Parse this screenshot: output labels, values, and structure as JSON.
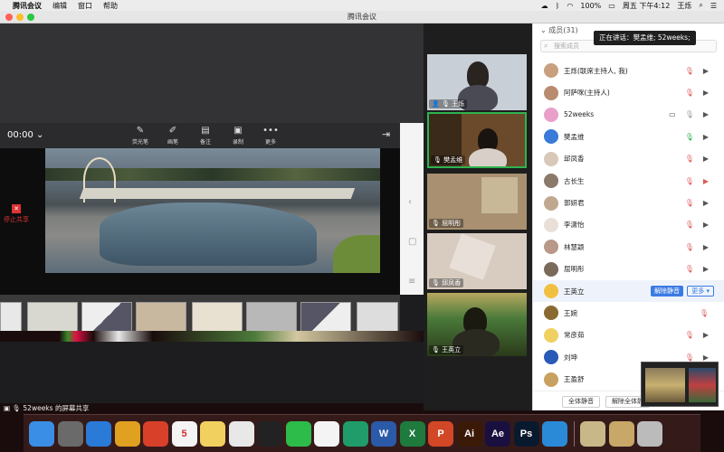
{
  "menubar": {
    "app_name": "腾讯会议",
    "items": [
      "编辑",
      "窗口",
      "帮助"
    ],
    "battery": "100%",
    "datetime": "周五 下午4:12",
    "user": "王烁"
  },
  "window": {
    "title": "腾讯会议"
  },
  "toolbar": {
    "timer": "00:00",
    "buttons": [
      {
        "label": "荧光笔",
        "icon": "highlighter-icon"
      },
      {
        "label": "画笔",
        "icon": "pen-icon"
      },
      {
        "label": "备注",
        "icon": "note-icon"
      },
      {
        "label": "录制",
        "icon": "record-icon"
      },
      {
        "label": "更多",
        "icon": "more-icon"
      }
    ]
  },
  "share": {
    "stop_label": "停止共享",
    "status": "52weeks 的屏幕共享"
  },
  "videos": [
    {
      "name": "王烁",
      "host": true
    },
    {
      "name": "樊孟维",
      "active": true
    },
    {
      "name": "屈明彤"
    },
    {
      "name": "邱凤香"
    },
    {
      "name": "王英立"
    }
  ],
  "participants_panel": {
    "header": "成员(31)",
    "search_placeholder": "搜索成员",
    "speaking": "正在讲话：樊孟维; 52weeks;",
    "members": [
      {
        "name": "王烁(联席主持人, 我)",
        "mic": "off",
        "cam": "on"
      },
      {
        "name": "阿萨咪(主持人)",
        "mic": "off",
        "cam": "on"
      },
      {
        "name": "52weeks",
        "mic": "muted",
        "cam": "on",
        "screen": true
      },
      {
        "name": "樊孟维",
        "mic": "on",
        "cam": "on"
      },
      {
        "name": "邱凤香",
        "mic": "off",
        "cam": "on"
      },
      {
        "name": "古长生",
        "mic": "off",
        "cam": "off"
      },
      {
        "name": "郭妍君",
        "mic": "off",
        "cam": "on"
      },
      {
        "name": "李潇怡",
        "mic": "off",
        "cam": "on"
      },
      {
        "name": "林慧颖",
        "mic": "off",
        "cam": "on"
      },
      {
        "name": "屈明彤",
        "mic": "off",
        "cam": "on"
      },
      {
        "name": "王英立",
        "mic": "off",
        "cam": "",
        "highlight": true
      },
      {
        "name": "王婉",
        "mic": "off",
        "cam": ""
      },
      {
        "name": "常彦茹",
        "mic": "off",
        "cam": "on"
      },
      {
        "name": "刘坤",
        "mic": "off",
        "cam": "on"
      },
      {
        "name": "王盈舒",
        "mic": "off",
        "cam": "on"
      }
    ],
    "unmute_label": "解除静音",
    "more_label": "更多",
    "mute_all_label": "全体静音",
    "unmute_all_label": "解除全体静"
  },
  "dock": {
    "apps": [
      {
        "icon": "finder-icon",
        "glyph": "",
        "color": "#3a8ee6"
      },
      {
        "icon": "launchpad-icon",
        "glyph": "",
        "color": "#6a6a6a"
      },
      {
        "icon": "safari-icon",
        "glyph": "",
        "color": "#2a7ad8"
      },
      {
        "icon": "chrome-canary-icon",
        "glyph": "",
        "color": "#e0a020"
      },
      {
        "icon": "chrome-icon",
        "glyph": "",
        "color": "#d8402a"
      },
      {
        "icon": "calendar-icon",
        "glyph": "5",
        "color": "#f4f4f4"
      },
      {
        "icon": "notes-icon",
        "glyph": "",
        "color": "#f2d060"
      },
      {
        "icon": "photos-icon",
        "glyph": "",
        "color": "#e8e8e8"
      },
      {
        "icon": "qq-icon",
        "glyph": "",
        "color": "#222222"
      },
      {
        "icon": "wechat-icon",
        "glyph": "",
        "color": "#2dbb4a"
      },
      {
        "icon": "tencent-meeting-icon",
        "glyph": "",
        "color": "#f4f4f4"
      },
      {
        "icon": "cad-icon",
        "glyph": "",
        "color": "#1f9c6a"
      },
      {
        "icon": "word-icon",
        "glyph": "W",
        "color": "#2a5aa8"
      },
      {
        "icon": "excel-icon",
        "glyph": "X",
        "color": "#1f7a3e"
      },
      {
        "icon": "powerpoint-icon",
        "glyph": "P",
        "color": "#d24726"
      },
      {
        "icon": "illustrator-icon",
        "glyph": "Ai",
        "color": "#3a1a06"
      },
      {
        "icon": "after-effects-icon",
        "glyph": "Ae",
        "color": "#1a1040"
      },
      {
        "icon": "photoshop-icon",
        "glyph": "Ps",
        "color": "#0a1a2e"
      },
      {
        "icon": "app-icon",
        "glyph": "",
        "color": "#2a8ad8"
      },
      {
        "icon": "downloads-icon",
        "glyph": "",
        "color": "#c8b888"
      },
      {
        "icon": "folder-icon",
        "glyph": "",
        "color": "#c8a868"
      },
      {
        "icon": "trash-icon",
        "glyph": "",
        "color": "#bbbbbb"
      }
    ]
  }
}
